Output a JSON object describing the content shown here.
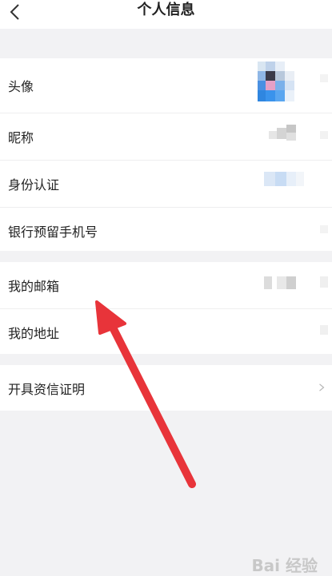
{
  "header": {
    "title": "个人信息",
    "back_icon": "back-chevron-icon"
  },
  "groups": [
    {
      "rows": [
        {
          "label": "头像",
          "kind": "avatar"
        },
        {
          "label": "昵称",
          "kind": "blurred"
        },
        {
          "label": "身份认证",
          "kind": "blurred"
        },
        {
          "label": "银行预留手机号",
          "kind": "blurred"
        }
      ]
    },
    {
      "rows": [
        {
          "label": "我的邮箱",
          "kind": "blurred"
        },
        {
          "label": "我的地址",
          "kind": "blurred"
        }
      ]
    },
    {
      "rows": [
        {
          "label": "开具资信证明",
          "kind": "chevron"
        }
      ]
    }
  ],
  "annotation": {
    "arrow_color": "#e8343a"
  },
  "watermark": {
    "text": "Bai 经验"
  },
  "colors": {
    "background": "#f2f2f4",
    "panel": "#ffffff",
    "divider": "#eeeeef"
  }
}
